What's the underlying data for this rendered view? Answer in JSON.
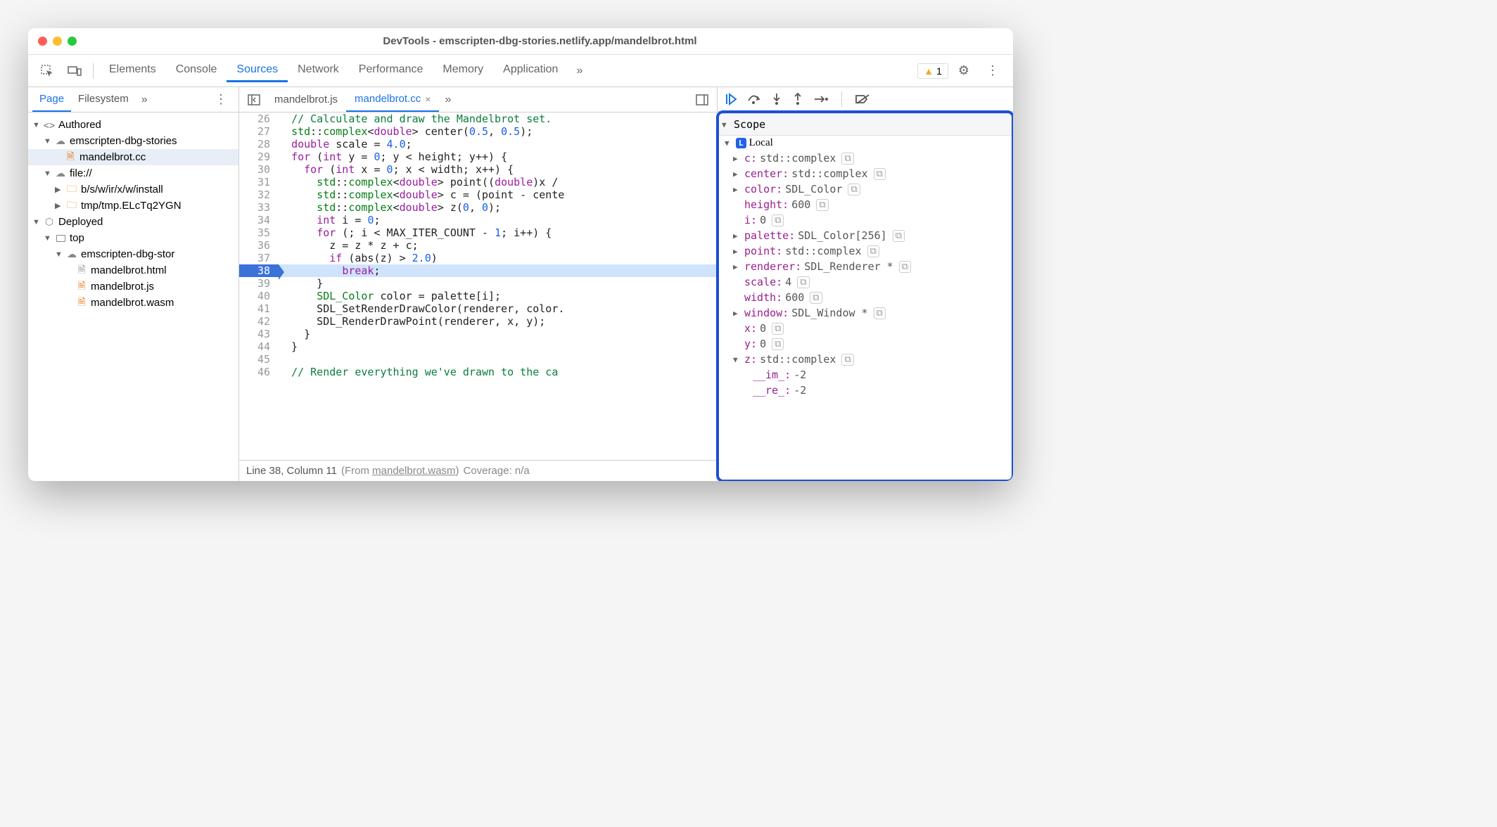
{
  "window": {
    "title": "DevTools - emscripten-dbg-stories.netlify.app/mandelbrot.html"
  },
  "toolbar": {
    "tabs": [
      "Elements",
      "Console",
      "Sources",
      "Network",
      "Performance",
      "Memory",
      "Application"
    ],
    "active": "Sources",
    "warning_count": "1"
  },
  "nav": {
    "tabs": [
      "Page",
      "Filesystem"
    ],
    "active": "Page",
    "tree": {
      "authored": "Authored",
      "cloud1": "emscripten-dbg-stories",
      "selected_file": "mandelbrot.cc",
      "file_scheme": "file://",
      "folder1": "b/s/w/ir/x/w/install",
      "folder2": "tmp/tmp.ELcTq2YGN",
      "deployed": "Deployed",
      "top": "top",
      "cloud2": "emscripten-dbg-stor",
      "files": [
        "mandelbrot.html",
        "mandelbrot.js",
        "mandelbrot.wasm"
      ]
    }
  },
  "editor": {
    "tabs": [
      "mandelbrot.js",
      "mandelbrot.cc"
    ],
    "active": "mandelbrot.cc",
    "lines": [
      {
        "n": 26,
        "html": "<span class='c-comment'>// Calculate and draw the Mandelbrot set.</span>"
      },
      {
        "n": 27,
        "html": "<span class='c-ns'>std</span>::<span class='c-type'>complex</span>&lt;<span class='c-kw'>double</span>&gt; center(<span class='c-num'>0.5</span>, <span class='c-num'>0.5</span>);"
      },
      {
        "n": 28,
        "html": "<span class='c-kw'>double</span> scale = <span class='c-num'>4.0</span>;"
      },
      {
        "n": 29,
        "html": "<span class='c-kw'>for</span> (<span class='c-kw'>int</span> y = <span class='c-num'>0</span>; y &lt; height; y++) {"
      },
      {
        "n": 30,
        "html": "  <span class='c-kw'>for</span> (<span class='c-kw'>int</span> x = <span class='c-num'>0</span>; x &lt; width; x++) {"
      },
      {
        "n": 31,
        "html": "    <span class='c-ns'>std</span>::<span class='c-type'>complex</span>&lt;<span class='c-kw'>double</span>&gt; point((<span class='c-kw'>double</span>)x /"
      },
      {
        "n": 32,
        "html": "    <span class='c-ns'>std</span>::<span class='c-type'>complex</span>&lt;<span class='c-kw'>double</span>&gt; c = (point - cente"
      },
      {
        "n": 33,
        "html": "    <span class='c-ns'>std</span>::<span class='c-type'>complex</span>&lt;<span class='c-kw'>double</span>&gt; z(<span class='c-num'>0</span>, <span class='c-num'>0</span>);"
      },
      {
        "n": 34,
        "html": "    <span class='c-kw'>int</span> i = <span class='c-num'>0</span>;"
      },
      {
        "n": 35,
        "html": "    <span class='c-kw'>for</span> (; i &lt; MAX_ITER_COUNT - <span class='c-num'>1</span>; i++) {"
      },
      {
        "n": 36,
        "html": "      z = z * z + c;"
      },
      {
        "n": 37,
        "html": "      <span class='c-kw'>if</span> (abs(z) &gt; <span class='c-num'>2.0</span>)"
      },
      {
        "n": 38,
        "html": "        <span class='c-kw'>break</span>;",
        "hl": true
      },
      {
        "n": 39,
        "html": "    }"
      },
      {
        "n": 40,
        "html": "    <span class='c-type'>SDL_Color</span> color = palette[i];"
      },
      {
        "n": 41,
        "html": "    SDL_SetRenderDrawColor(renderer, color."
      },
      {
        "n": 42,
        "html": "    SDL_RenderDrawPoint(renderer, x, y);"
      },
      {
        "n": 43,
        "html": "  }"
      },
      {
        "n": 44,
        "html": "}"
      },
      {
        "n": 45,
        "html": ""
      },
      {
        "n": 46,
        "html": "<span class='c-comment'>// Render everything we've drawn to the ca</span>"
      }
    ],
    "status": {
      "pos": "Line 38, Column 11",
      "from_label": "(From ",
      "from_file": "mandelbrot.wasm",
      "from_close": ")",
      "coverage": "Coverage: n/a"
    }
  },
  "scope": {
    "title": "Scope",
    "local_label": "Local",
    "vars": [
      {
        "exp": true,
        "name": "c",
        "type": "std::complex<double>",
        "mem": true
      },
      {
        "exp": true,
        "name": "center",
        "type": "std::complex<double>",
        "mem": true
      },
      {
        "exp": true,
        "name": "color",
        "type": "SDL_Color",
        "mem": true
      },
      {
        "exp": false,
        "name": "height",
        "type": "600",
        "mem": true
      },
      {
        "exp": false,
        "name": "i",
        "type": "0",
        "mem": true
      },
      {
        "exp": true,
        "name": "palette",
        "type": "SDL_Color[256]",
        "mem": true
      },
      {
        "exp": true,
        "name": "point",
        "type": "std::complex<double>",
        "mem": true
      },
      {
        "exp": true,
        "name": "renderer",
        "type": "SDL_Renderer *",
        "mem": true
      },
      {
        "exp": false,
        "name": "scale",
        "type": "4",
        "mem": true
      },
      {
        "exp": false,
        "name": "width",
        "type": "600",
        "mem": true
      },
      {
        "exp": true,
        "name": "window",
        "type": "SDL_Window *",
        "mem": true
      },
      {
        "exp": false,
        "name": "x",
        "type": "0",
        "mem": true
      },
      {
        "exp": false,
        "name": "y",
        "type": "0",
        "mem": true
      },
      {
        "exp": true,
        "open": true,
        "name": "z",
        "type": "std::complex<double>",
        "mem": true
      }
    ],
    "z_children": [
      {
        "name": "__im_",
        "type": "-2"
      },
      {
        "name": "__re_",
        "type": "-2"
      }
    ]
  }
}
